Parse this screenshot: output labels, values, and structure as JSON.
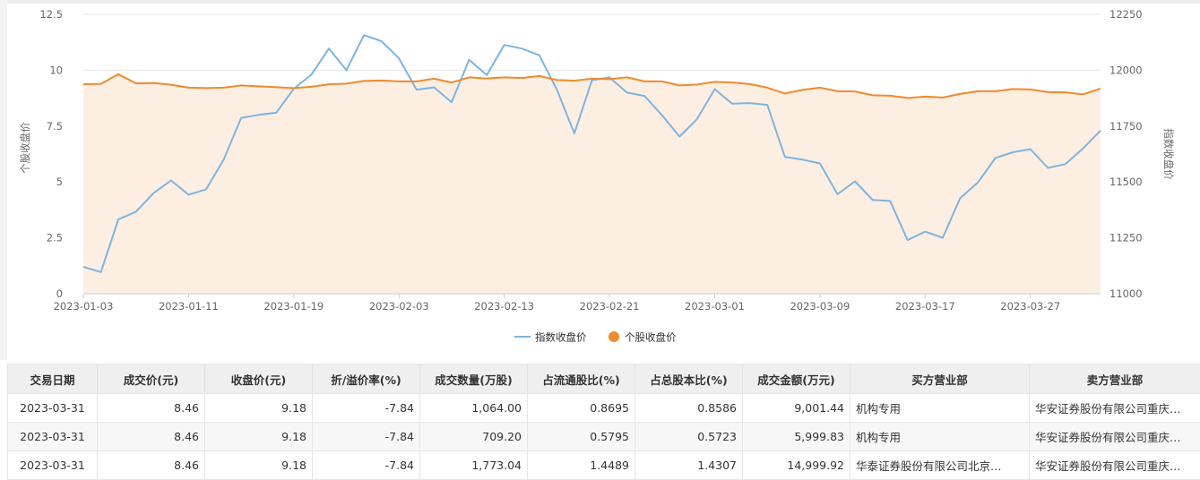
{
  "chart_data": {
    "type": "line",
    "x": [
      "2023-01-03",
      "2023-01-04",
      "2023-01-05",
      "2023-01-06",
      "2023-01-09",
      "2023-01-10",
      "2023-01-11",
      "2023-01-12",
      "2023-01-13",
      "2023-01-16",
      "2023-01-17",
      "2023-01-18",
      "2023-01-19",
      "2023-01-20",
      "2023-01-30",
      "2023-01-31",
      "2023-02-01",
      "2023-02-02",
      "2023-02-03",
      "2023-02-06",
      "2023-02-07",
      "2023-02-08",
      "2023-02-09",
      "2023-02-10",
      "2023-02-13",
      "2023-02-14",
      "2023-02-15",
      "2023-02-16",
      "2023-02-17",
      "2023-02-20",
      "2023-02-21",
      "2023-02-22",
      "2023-02-23",
      "2023-02-24",
      "2023-02-27",
      "2023-02-28",
      "2023-03-01",
      "2023-03-02",
      "2023-03-03",
      "2023-03-06",
      "2023-03-07",
      "2023-03-08",
      "2023-03-09",
      "2023-03-10",
      "2023-03-13",
      "2023-03-14",
      "2023-03-15",
      "2023-03-16",
      "2023-03-17",
      "2023-03-20",
      "2023-03-21",
      "2023-03-22",
      "2023-03-23",
      "2023-03-24",
      "2023-03-27",
      "2023-03-28",
      "2023-03-29",
      "2023-03-30",
      "2023-03-31"
    ],
    "x_ticks": [
      "2023-01-03",
      "2023-01-11",
      "2023-01-19",
      "2023-02-03",
      "2023-02-13",
      "2023-02-21",
      "2023-03-01",
      "2023-03-09",
      "2023-03-17",
      "2023-03-27"
    ],
    "series": [
      {
        "name": "指数收盘价",
        "axis": "right",
        "color": "#7cb5e0",
        "values": [
          11120,
          11097,
          11333,
          11367,
          11450,
          11507,
          11443,
          11467,
          11600,
          11787,
          11800,
          11810,
          11917,
          11980,
          12097,
          12000,
          12157,
          12130,
          12053,
          11913,
          11923,
          11857,
          12047,
          11978,
          12113,
          12097,
          12067,
          11913,
          11717,
          11955,
          11968,
          11900,
          11885,
          11798,
          11703,
          11782,
          11915,
          11850,
          11853,
          11845,
          11612,
          11600,
          11583,
          11445,
          11503,
          11420,
          11415,
          11240,
          11278,
          11250,
          11428,
          11497,
          11607,
          11633,
          11647,
          11563,
          11580,
          11650,
          11730
        ]
      },
      {
        "name": "个股收盘价",
        "axis": "left",
        "color": "#ef8b2c",
        "values": [
          9.37,
          9.39,
          9.82,
          9.41,
          9.43,
          9.35,
          9.22,
          9.2,
          9.22,
          9.32,
          9.28,
          9.24,
          9.2,
          9.26,
          9.37,
          9.4,
          9.52,
          9.54,
          9.5,
          9.5,
          9.62,
          9.45,
          9.68,
          9.63,
          9.68,
          9.65,
          9.74,
          9.56,
          9.53,
          9.62,
          9.6,
          9.68,
          9.5,
          9.5,
          9.32,
          9.36,
          9.48,
          9.45,
          9.38,
          9.22,
          8.96,
          9.12,
          9.22,
          9.06,
          9.05,
          8.88,
          8.86,
          8.76,
          8.82,
          8.78,
          8.94,
          9.06,
          9.06,
          9.16,
          9.14,
          9.02,
          9.01,
          8.92,
          9.18
        ]
      }
    ],
    "y_left": {
      "label": "个股收盘价",
      "min": 0,
      "max": 12.5,
      "ticks": [
        "0",
        "2.5",
        "5",
        "7.5",
        "10",
        "12.5"
      ]
    },
    "y_right": {
      "label": "指数收盘价",
      "min": 11000,
      "max": 12250,
      "ticks": [
        "11000",
        "11250",
        "11500",
        "11750",
        "12000",
        "12250"
      ]
    },
    "legend_position": "bottom",
    "grid": true,
    "area_fill_color": "#fdeee2"
  },
  "table": {
    "headers": [
      "交易日期",
      "成交价(元)",
      "收盘价(元)",
      "折/溢价率(%)",
      "成交数量(万股)",
      "占流通股比(%)",
      "占总股本比(%)",
      "成交金额(万元)",
      "买方营业部",
      "卖方营业部"
    ],
    "rows": [
      [
        "2023-03-31",
        "8.46",
        "9.18",
        "-7.84",
        "1,064.00",
        "0.8695",
        "0.8586",
        "9,001.44",
        "机构专用",
        "华安证券股份有限公司重庆…"
      ],
      [
        "2023-03-31",
        "8.46",
        "9.18",
        "-7.84",
        "709.20",
        "0.5795",
        "0.5723",
        "5,999.83",
        "机构专用",
        "华安证券股份有限公司重庆…"
      ],
      [
        "2023-03-31",
        "8.46",
        "9.18",
        "-7.84",
        "1,773.04",
        "1.4489",
        "1.4307",
        "14,999.92",
        "华泰证券股份有限公司北京…",
        "华安证券股份有限公司重庆…"
      ]
    ]
  }
}
